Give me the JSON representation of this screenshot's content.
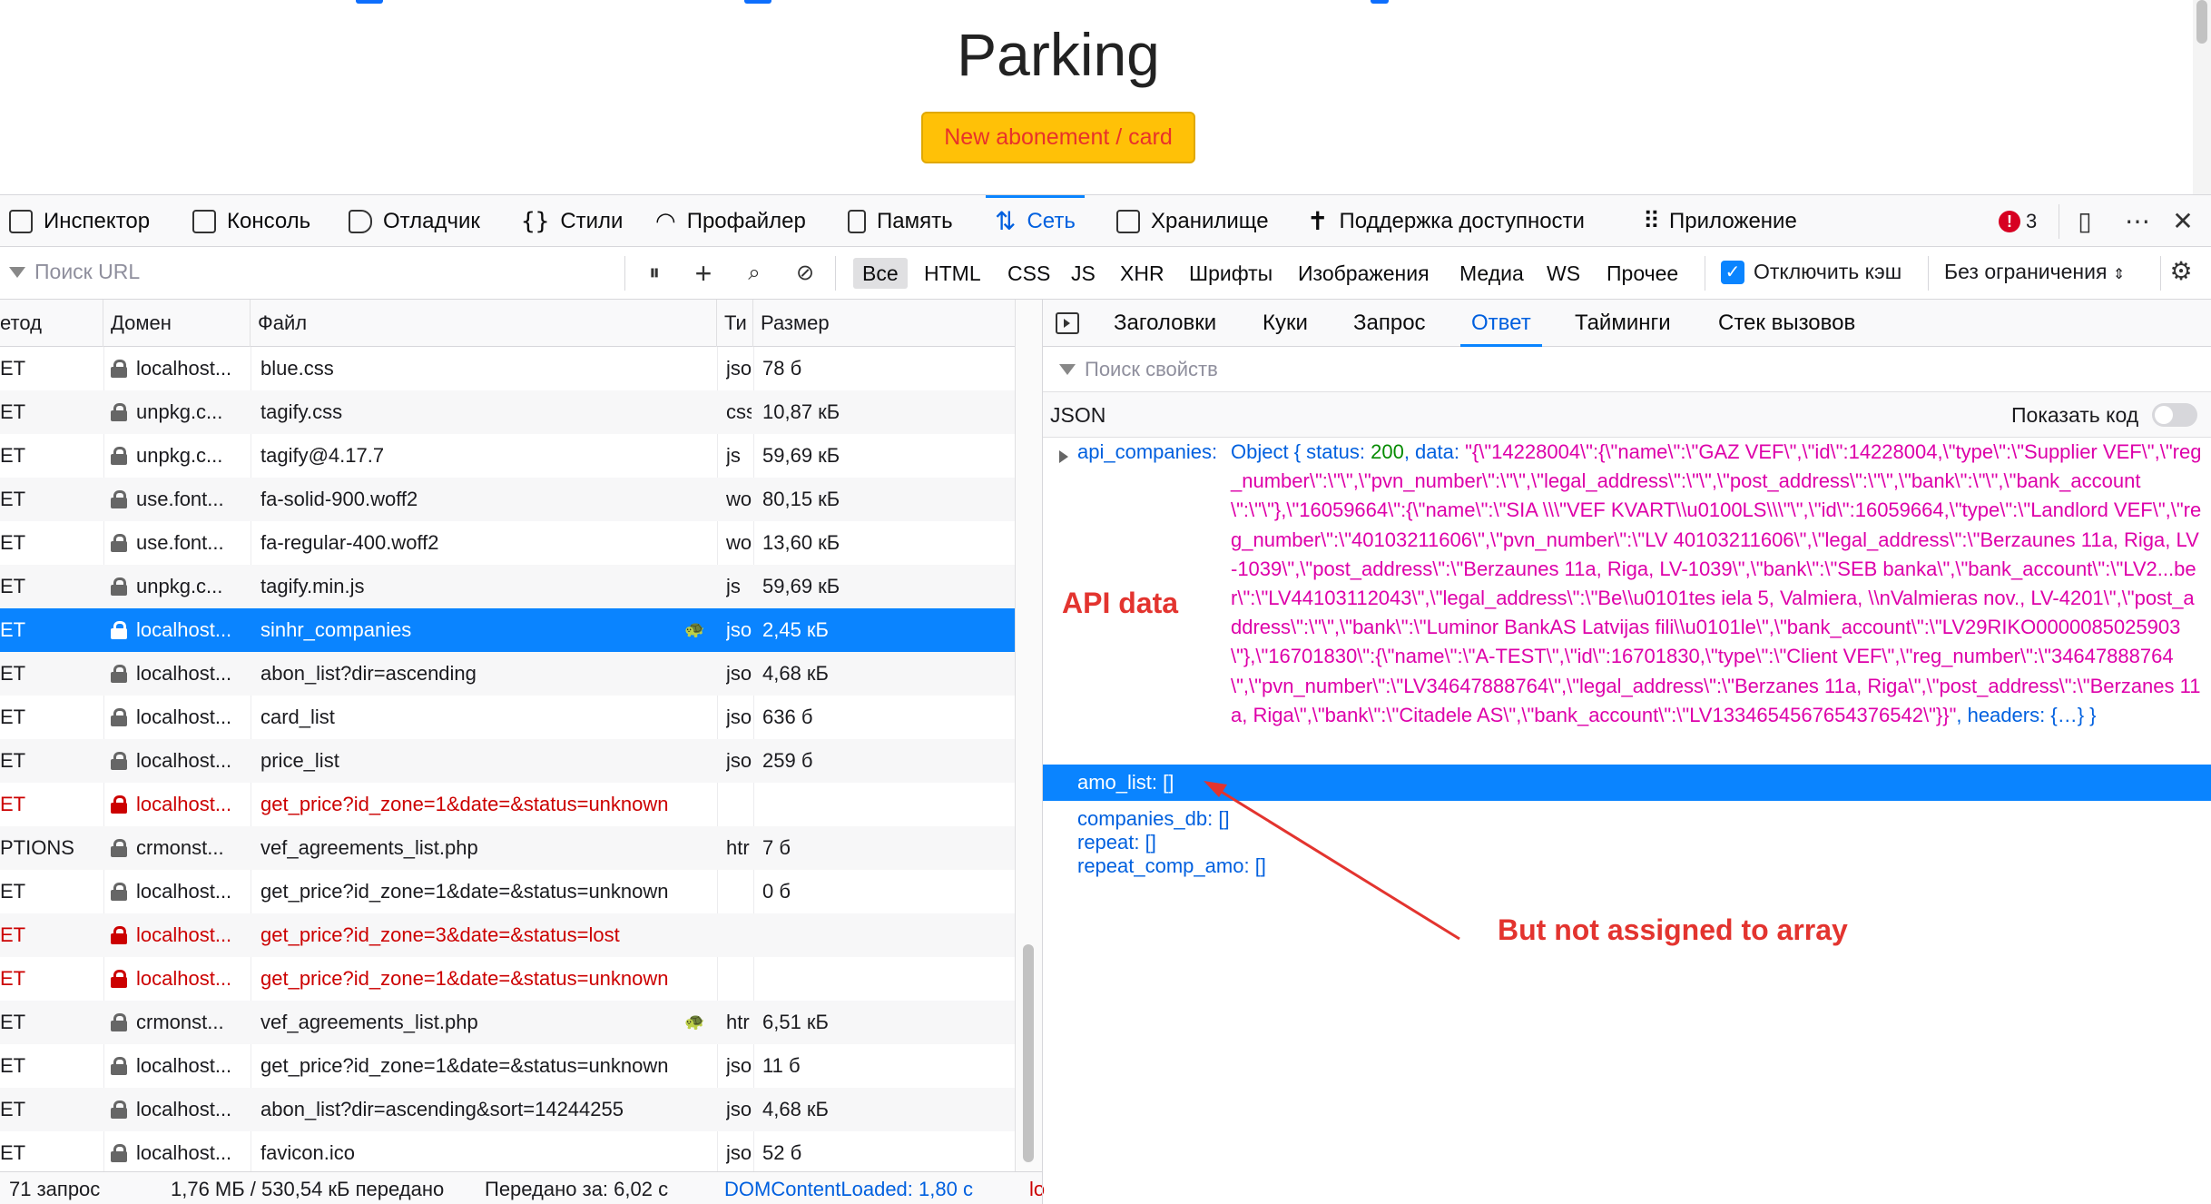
{
  "page": {
    "title": "Parking",
    "new_button": "New abonement / card"
  },
  "devtools": {
    "tabs": [
      {
        "label": "Инспектор",
        "icon": "inspector-icon"
      },
      {
        "label": "Консоль",
        "icon": "console-icon"
      },
      {
        "label": "Отладчик",
        "icon": "debugger-icon"
      },
      {
        "label": "Стили",
        "icon": "style-editor-icon"
      },
      {
        "label": "Профайлер",
        "icon": "profiler-icon"
      },
      {
        "label": "Память",
        "icon": "memory-icon"
      },
      {
        "label": "Сеть",
        "icon": "network-icon",
        "active": true
      },
      {
        "label": "Хранилище",
        "icon": "storage-icon"
      },
      {
        "label": "Поддержка доступности",
        "icon": "accessibility-icon"
      },
      {
        "label": "Приложение",
        "icon": "application-icon"
      }
    ],
    "error_count": "3"
  },
  "filter": {
    "url_placeholder": "Поиск URL",
    "types": [
      "Все",
      "HTML",
      "CSS",
      "JS",
      "XHR",
      "Шрифты",
      "Изображения",
      "Медиа",
      "WS",
      "Прочее"
    ],
    "selected_type": "Все",
    "disable_cache": "Отключить кэш",
    "throttle": "Без ограничения"
  },
  "table": {
    "headers": {
      "method": "етод",
      "domain": "Домен",
      "file": "Файл",
      "type": "Ти",
      "size": "Размер"
    },
    "rows": [
      {
        "method": "ET",
        "domain": "localhost...",
        "file": "blue.css",
        "type": "jsoı",
        "size": "78 б"
      },
      {
        "method": "ET",
        "domain": "unpkg.c...",
        "file": "tagify.css",
        "type": "css",
        "size": "10,87 кБ"
      },
      {
        "method": "ET",
        "domain": "unpkg.c...",
        "file": "tagify@4.17.7",
        "type": "js",
        "size": "59,69 кБ"
      },
      {
        "method": "ET",
        "domain": "use.font...",
        "file": "fa-solid-900.woff2",
        "type": "wo",
        "size": "80,15 кБ"
      },
      {
        "method": "ET",
        "domain": "use.font...",
        "file": "fa-regular-400.woff2",
        "type": "wo",
        "size": "13,60 кБ"
      },
      {
        "method": "ET",
        "domain": "unpkg.c...",
        "file": "tagify.min.js",
        "type": "js",
        "size": "59,69 кБ"
      },
      {
        "method": "ET",
        "domain": "localhost...",
        "file": "sinhr_companies",
        "type": "jsoı",
        "size": "2,45 кБ",
        "selected": true,
        "slow": true
      },
      {
        "method": "ET",
        "domain": "localhost...",
        "file": "abon_list?dir=ascending",
        "type": "jsoı",
        "size": "4,68 кБ"
      },
      {
        "method": "ET",
        "domain": "localhost...",
        "file": "card_list",
        "type": "jsoı",
        "size": "636 б"
      },
      {
        "method": "ET",
        "domain": "localhost...",
        "file": "price_list",
        "type": "jsoı",
        "size": "259 б"
      },
      {
        "method": "ET",
        "domain": "localhost...",
        "file": "get_price?id_zone=1&date=&status=unknown",
        "type": "",
        "size": "",
        "failed": true
      },
      {
        "method": "PTIONS",
        "domain": "crmonst...",
        "file": "vef_agreements_list.php",
        "type": "htr",
        "size": "7 б"
      },
      {
        "method": "ET",
        "domain": "localhost...",
        "file": "get_price?id_zone=1&date=&status=unknown",
        "type": "",
        "size": "0 б"
      },
      {
        "method": "ET",
        "domain": "localhost...",
        "file": "get_price?id_zone=3&date=&status=lost",
        "type": "",
        "size": "",
        "failed": true
      },
      {
        "method": "ET",
        "domain": "localhost...",
        "file": "get_price?id_zone=1&date=&status=unknown",
        "type": "",
        "size": "",
        "failed": true
      },
      {
        "method": "ET",
        "domain": "crmonst...",
        "file": "vef_agreements_list.php",
        "type": "htr",
        "size": "6,51 кБ",
        "slow": true
      },
      {
        "method": "ET",
        "domain": "localhost...",
        "file": "get_price?id_zone=1&date=&status=unknown",
        "type": "jsoı",
        "size": "11 б"
      },
      {
        "method": "ET",
        "domain": "localhost...",
        "file": "abon_list?dir=ascending&sort=14244255",
        "type": "jsoı",
        "size": "4,68 кБ"
      },
      {
        "method": "ET",
        "domain": "localhost...",
        "file": "favicon.ico",
        "type": "jsoı",
        "size": "52 б"
      }
    ]
  },
  "status_bar": {
    "requests": "71 запрос",
    "transferred": "1,76 МБ / 530,54 кБ передано",
    "finish": "Передано за: 6,02 с",
    "dom_loaded": "DOMContentLoaded: 1,80 с",
    "load": "lo"
  },
  "details": {
    "tabs": [
      "Заголовки",
      "Куки",
      "Запрос",
      "Ответ",
      "Тайминги",
      "Стек вызовов"
    ],
    "active_tab": "Ответ",
    "filter_placeholder": "Поиск свойств",
    "json_label": "JSON",
    "raw_toggle": "Показать код",
    "api_key": "api_companies:",
    "api_obj_open": "Object { status:",
    "api_status": "200",
    "api_data_key": ", data:",
    "api_data_lines": [
      "\"{\\\"14228004\\\":{\\\"name\\\":\\\"GAZ VEF\\\",\\\"id\\\":14228004,\\\"type\\\":\\\"Supplier",
      "VEF\\\",\\\"reg_number\\\":\\\"\\\",\\\"pvn_number\\\":\\\"\\\",\\\"legal_address\\\":\\\"\\\",\\\"post_address\\\":\\\"\\\",\\\"bank\\\":\\\"\\\",",
      "\\\"bank_account\\\":\\\"\\\"},\\\"16059664\\\":{\\\"name\\\":\\\"SIA \\\\\\\"VEF KVART\\\\u0100LS\\\\\\\"\\\",\\\"id\\\":16059664,",
      "\\\"type\\\":\\\"Landlord VEF\\\",\\\"reg_number\\\":\\\"40103211606\\\",\\\"pvn_number\\\":\\\"LV 40103211606\\\",",
      "\\\"legal_address\\\":\\\"Berzaunes 11a, Riga, LV-1039\\\",\\\"post_address\\\":\\\"Berzaunes 11a, Riga, LV-1039\\\",",
      "\\\"bank\\\":\\\"SEB banka\\\",\\\"bank_account\\\":\\\"LV2...ber\\\":\\\"LV44103112043\\\",\\\"legal_address\\\":\\\"Be",
      "\\\\u0101tes iela 5, Valmiera, \\\\nValmieras nov., LV-4201\\\",\\\"post_address\\\":\\\"\\\",\\\"bank\\\":\\\"Luminor Bank",
      "AS Latvijas fili\\\\u0101le\\\",\\\"bank_account\\\":\\\"LV29RIKO0000085025903\\\"},\\\"16701830\\\":{\\\"name",
      "\\\":\\\"A-TEST\\\",\\\"id\\\":16701830,\\\"type\\\":\\\"Client VEF\\\",\\\"reg_number\\\":\\\"34647888764\\\",\\\"pvn_number",
      "\\\":\\\"LV34647888764\\\",\\\"legal_address\\\":\\\"Berzanes 11a, Riga\\\",\\\"post_address\\\":\\\"Berzanes 11a, Riga\\\",",
      "\\\"bank\\\":\\\"Citadele AS\\\",\\\"bank_account\\\":\\\"LV1334654567654376542\\\"}}\""
    ],
    "api_tail": ", headers: {…} }",
    "props": [
      {
        "key": "amo_list:",
        "value": "[]"
      },
      {
        "key": "companies_db:",
        "value": "[]"
      },
      {
        "key": "repeat:",
        "value": "[]"
      },
      {
        "key": "repeat_comp_amo:",
        "value": "[]"
      }
    ]
  },
  "annotations": {
    "api_data": "API data",
    "not_assigned": "But not assigned to array"
  },
  "colors": {
    "accent": "#0a84ff",
    "annotation": "#e3342f",
    "string": "#dd00a9",
    "number": "#058b00",
    "key": "#0060df"
  }
}
